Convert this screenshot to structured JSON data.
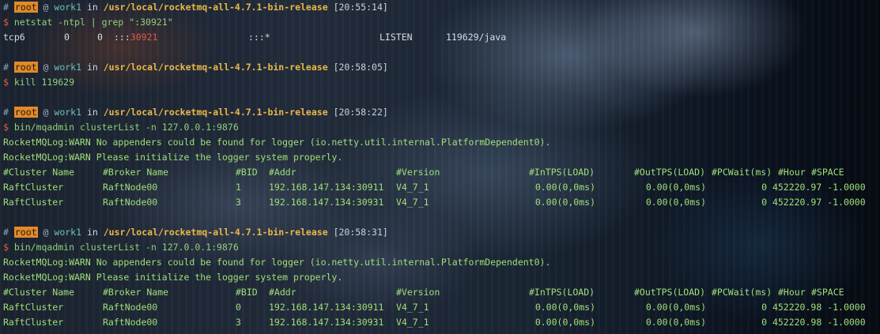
{
  "prompts": [
    {
      "hash": "#",
      "user": "root",
      "at": "@",
      "host": "work1",
      "in": "in",
      "path": "/usr/local/rocketmq-all-4.7.1-bin-release",
      "time": "[20:55:14]",
      "command": "netstat -ntpl | grep \":30921\""
    },
    {
      "hash": "#",
      "user": "root",
      "at": "@",
      "host": "work1",
      "in": "in",
      "path": "/usr/local/rocketmq-all-4.7.1-bin-release",
      "time": "[20:58:05]",
      "command": "kill 119629"
    },
    {
      "hash": "#",
      "user": "root",
      "at": "@",
      "host": "work1",
      "in": "in",
      "path": "/usr/local/rocketmq-all-4.7.1-bin-release",
      "time": "[20:58:22]",
      "command": "bin/mqadmin clusterList -n 127.0.0.1:9876"
    },
    {
      "hash": "#",
      "user": "root",
      "at": "@",
      "host": "work1",
      "in": "in",
      "path": "/usr/local/rocketmq-all-4.7.1-bin-release",
      "time": "[20:58:31]",
      "command": "bin/mqadmin clusterList -n 127.0.0.1:9876"
    }
  ],
  "dollar": "$",
  "netstat": {
    "proto": "tcp6",
    "recvq": "0",
    "sendq": "0",
    "local_prefix": ":::",
    "local_port": "30921",
    "foreign": ":::*",
    "state": "LISTEN",
    "pid": "119629/java"
  },
  "warnings": [
    "RocketMQLog:WARN No appenders could be found for logger (io.netty.util.internal.PlatformDependent0).",
    "RocketMQLog:WARN Please initialize the logger system properly."
  ],
  "table_header": [
    "#Cluster Name",
    "#Broker Name",
    "#BID",
    "#Addr",
    "#Version",
    "#InTPS(LOAD)",
    "#OutTPS(LOAD)",
    "#PCWait(ms)",
    "#Hour",
    "#SPACE"
  ],
  "cluster_list_1": [
    [
      "RaftCluster",
      "RaftNode00",
      "1",
      "192.168.147.134:30911",
      "V4_7_1",
      "0.00(0,0ms)",
      "0.00(0,0ms)",
      "0",
      "452220.97",
      "-1.0000"
    ],
    [
      "RaftCluster",
      "RaftNode00",
      "3",
      "192.168.147.134:30931",
      "V4_7_1",
      "0.00(0,0ms)",
      "0.00(0,0ms)",
      "0",
      "452220.97",
      "-1.0000"
    ]
  ],
  "cluster_list_2": [
    [
      "RaftCluster",
      "RaftNode00",
      "0",
      "192.168.147.134:30911",
      "V4_7_1",
      "0.00(0,0ms)",
      "0.00(0,0ms)",
      "0",
      "452220.98",
      "-1.0000"
    ],
    [
      "RaftCluster",
      "RaftNode00",
      "3",
      "192.168.147.134:30931",
      "V4_7_1",
      "0.00(0,0ms)",
      "0.00(0,0ms)",
      "0",
      "452220.98",
      "-1.0000"
    ]
  ]
}
